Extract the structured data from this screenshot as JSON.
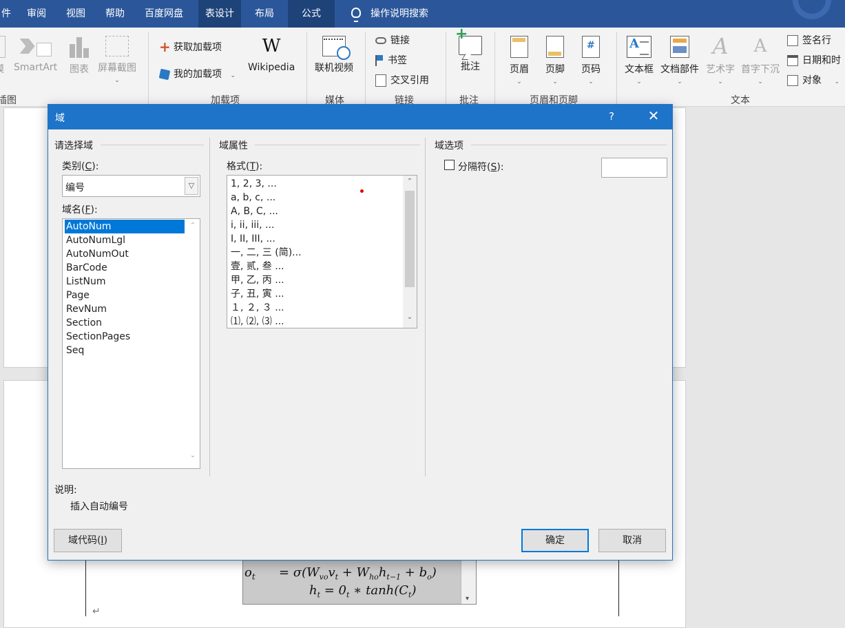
{
  "ribbon": {
    "tabs": [
      "件",
      "审阅",
      "视图",
      "帮助",
      "百度网盘",
      "表设计",
      "布局",
      "公式"
    ],
    "active_tab": "表设计",
    "tell_me": "操作说明搜索",
    "illustrations": {
      "model_partial": "模",
      "smartart": "SmartArt",
      "chart": "图表",
      "screenshot": "屏幕截图",
      "group_partial": "插图"
    },
    "addins": {
      "get": "获取加载项",
      "mine": "我的加载项",
      "wikipedia": "Wikipedia",
      "group": "加载项"
    },
    "media": {
      "video": "联机视频",
      "group": "媒体"
    },
    "links": {
      "link": "链接",
      "bookmark": "书签",
      "crossref": "交叉引用",
      "group": "链接"
    },
    "comments": {
      "comment": "批注",
      "group": "批注"
    },
    "header_footer": {
      "header": "页眉",
      "footer": "页脚",
      "page_number": "页码",
      "group": "页眉和页脚"
    },
    "text": {
      "textbox": "文本框",
      "quickparts": "文档部件",
      "wordart": "艺术字",
      "dropcap": "首字下沉",
      "signature": "签名行",
      "datetime": "日期和时",
      "object": "对象",
      "group": "文本"
    }
  },
  "dialog": {
    "title": "域",
    "help": "?",
    "close": "✕",
    "choose_field": {
      "heading": "请选择域",
      "category_label": "类别(",
      "category_key": "C",
      "category_label_end": "):",
      "category_value": "编号",
      "fieldname_label": "域名(",
      "fieldname_key": "F",
      "fieldname_label_end": "):",
      "fields": [
        "AutoNum",
        "AutoNumLgl",
        "AutoNumOut",
        "BarCode",
        "ListNum",
        "Page",
        "RevNum",
        "Section",
        "SectionPages",
        "Seq"
      ],
      "selected": "AutoNum"
    },
    "properties": {
      "heading": "域属性",
      "format_label": "格式(",
      "format_key": "T",
      "format_label_end": "):",
      "formats": [
        "1, 2, 3, ...",
        "a, b, c, ...",
        "A, B, C, ...",
        "i, ii, iii, ...",
        "I, II, III, ...",
        "一, 二, 三 (简)...",
        "壹, 贰, 叁 ...",
        "甲, 乙, 丙 ...",
        "子, 丑, 寅 ...",
        "１, ２, ３ ...",
        "⑴, ⑵, ⑶ ..."
      ]
    },
    "options": {
      "heading": "域选项",
      "separator_label": "分隔符(",
      "separator_key": "S",
      "separator_label_end": "):",
      "separator_checked": false,
      "separator_value": ""
    },
    "description": {
      "label": "说明:",
      "text": "插入自动编号"
    },
    "buttons": {
      "field_codes": "域代码(",
      "field_codes_key": "I",
      "field_codes_end": ")",
      "ok": "确定",
      "cancel": "取消"
    }
  },
  "document": {
    "eq_line1_lhs": "o",
    "eq_line1_lhs_sub": "t",
    "eq_line1_rhs": "= σ(W",
    "eq_line1_rhs_rest": "v",
    "eq_line2": "h",
    "para_mark": "↵"
  }
}
